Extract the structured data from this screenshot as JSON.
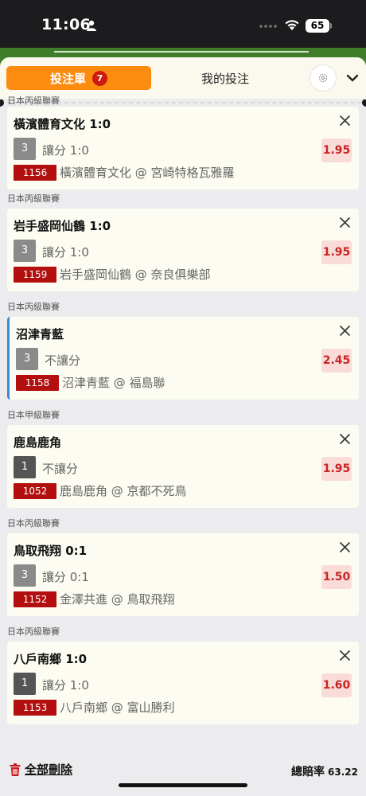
{
  "status_bar": {
    "time": "11:06",
    "battery": "65"
  },
  "header": {
    "bet_slip_label": "投注單",
    "bet_slip_count": "7",
    "my_bets_label": "我的投注"
  },
  "bets": [
    {
      "league": "日本丙級聯賽",
      "title": "橫濱體育文化 1:0",
      "num": "3",
      "market": "讓分 1:0",
      "code": "1156",
      "selection": "橫濱體育文化 @ 宮崎特格瓦雅羅",
      "odds": "1.95"
    },
    {
      "league": "日本丙級聯賽",
      "title": "岩手盛岡仙鶴 1:0",
      "num": "3",
      "market": "讓分 1:0",
      "code": "1159",
      "selection": "岩手盛岡仙鶴 @ 奈良俱樂部",
      "odds": "1.95"
    },
    {
      "league": "日本丙級聯賽",
      "title": "沼津青藍",
      "num": "3",
      "market": "不讓分",
      "code": "1158",
      "selection": "沼津青藍 @ 福島聯",
      "odds": "2.45"
    },
    {
      "league": "日本甲級聯賽",
      "title": "鹿島鹿角",
      "num": "1",
      "market": "不讓分",
      "code": "1052",
      "selection": "鹿島鹿角 @ 京都不死鳥",
      "odds": "1.95"
    },
    {
      "league": "日本丙級聯賽",
      "title": "鳥取飛翔 0:1",
      "num": "3",
      "market": "讓分 0:1",
      "code": "1152",
      "selection": "金澤共進 @ 鳥取飛翔",
      "odds": "1.50"
    },
    {
      "league": "日本丙級聯賽",
      "title": "八戶南鄉 1:0",
      "num": "1",
      "market": "讓分 1:0",
      "code": "1153",
      "selection": "八戶南鄉 @ 富山勝利",
      "odds": "1.60"
    }
  ],
  "footer": {
    "delete_all_label": "全部刪除",
    "total_odds_label": "總賠率",
    "total_odds_value": "63.22"
  },
  "colors": {
    "accent": "#fb8c10",
    "code_red": "#b30f0f",
    "odds_bg": "#f9dcd8",
    "odds_text": "#c82424",
    "active_border": "#3f88d6"
  }
}
